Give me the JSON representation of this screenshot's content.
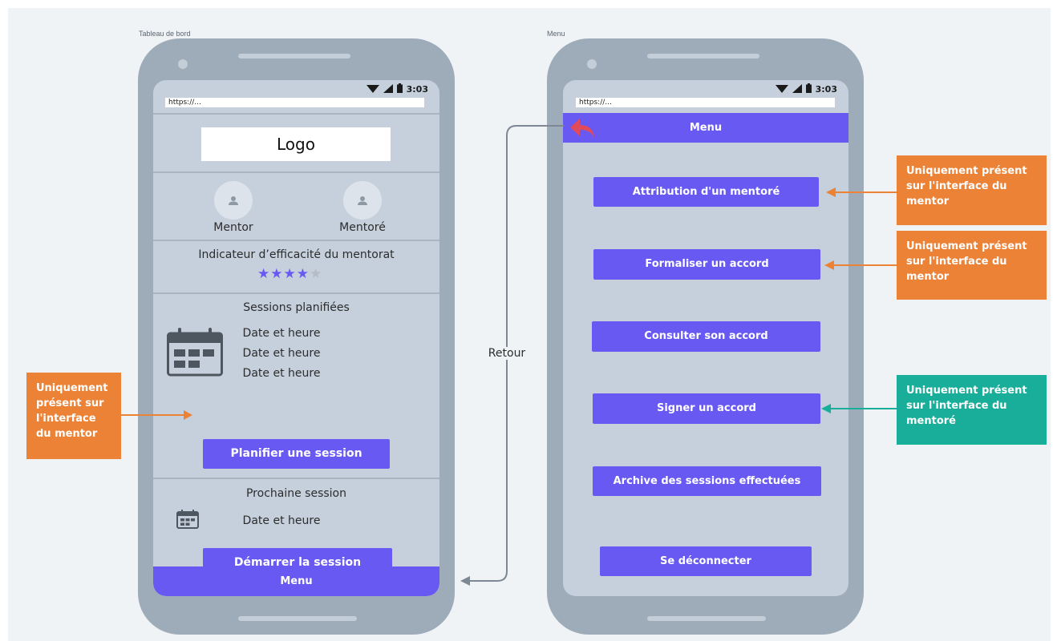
{
  "labels": {
    "dashboard_frame": "Tableau de bord",
    "menu_frame": "Menu"
  },
  "status_bar": {
    "time": "3:03"
  },
  "url_bar": {
    "text": "https://..."
  },
  "dashboard": {
    "logo": "Logo",
    "mentor_label": "Mentor",
    "mentore_label": "Mentoré",
    "indicator_title": "Indicateur d’efficacité du mentorat",
    "rating": {
      "value": 4,
      "max": 5
    },
    "sessions_title": "Sessions planifiées",
    "sessions": [
      "Date et heure",
      "Date et heure",
      "Date et heure"
    ],
    "plan_button": "Planifier une session",
    "next_title": "Prochaine session",
    "next_datetime": "Date et heure",
    "start_button": "Démarrer la session",
    "menu_bar": "Menu"
  },
  "menu_screen": {
    "header": "Menu",
    "items": [
      "Attribution d'un mentoré",
      "Formaliser un accord",
      "Consulter son accord",
      "Signer un accord",
      "Archive des sessions effectuées",
      "Se déconnecter"
    ]
  },
  "connector_label": "Retour",
  "annotations": [
    "Uniquement présent sur l'interface du mentor",
    "Uniquement présent sur l'interface du mentor",
    "Uniquement présent sur l'interface du mentor",
    "Uniquement présent sur l'interface du mentoré"
  ],
  "colors": {
    "accent": "#6859f2",
    "orange": "#ec8236",
    "teal": "#19ae9a",
    "back_arrow": "#e04a5a",
    "star_on": "#6859f2",
    "star_off": "#b4bcc6"
  }
}
